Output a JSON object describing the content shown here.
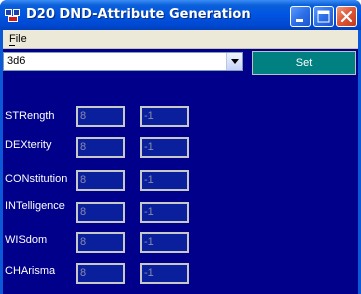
{
  "window": {
    "title": "D20 DND-Attribute Generation"
  },
  "menu": {
    "file_label": "File"
  },
  "dice": {
    "selected": "3d6"
  },
  "set_button_label": "Set",
  "attributes": [
    {
      "label": "STRength",
      "score": "8",
      "modifier": "-1"
    },
    {
      "label": "DEXterity",
      "score": "8",
      "modifier": "-1"
    },
    {
      "label": "CONstitution",
      "score": "8",
      "modifier": "-1"
    },
    {
      "label": "INTelligence",
      "score": "8",
      "modifier": "-1"
    },
    {
      "label": "WISdom",
      "score": "8",
      "modifier": "-1"
    },
    {
      "label": "CHArisma",
      "score": "8",
      "modifier": "-1"
    }
  ],
  "colors": {
    "client_background": "#00008b",
    "set_button": "#008080",
    "titlebar": "#0054e3"
  }
}
